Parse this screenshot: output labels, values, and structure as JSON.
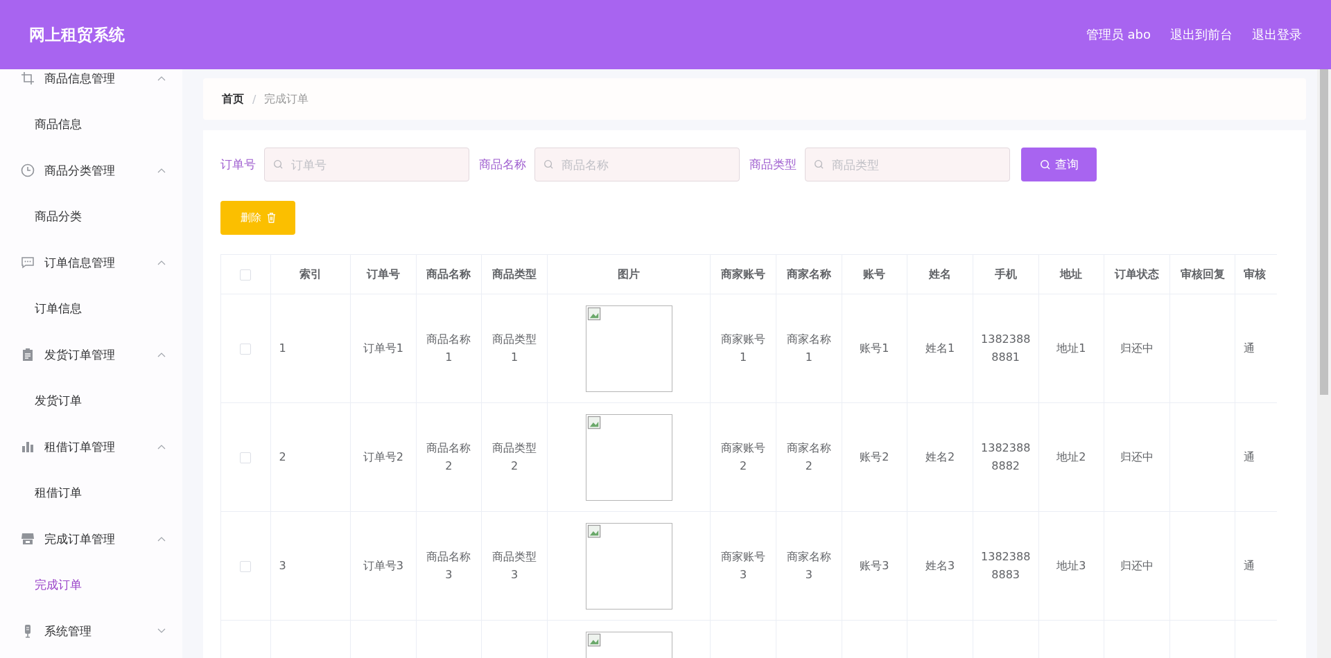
{
  "header": {
    "title": "网上租贸系统",
    "links": [
      "管理员 abo",
      "退出到前台",
      "退出登录"
    ]
  },
  "sidebar": {
    "groups": [
      {
        "label": "商品信息管理",
        "expanded": true,
        "children": [
          {
            "label": "商品信息",
            "selected": false
          }
        ]
      },
      {
        "label": "商品分类管理",
        "expanded": true,
        "children": [
          {
            "label": "商品分类",
            "selected": false
          }
        ]
      },
      {
        "label": "订单信息管理",
        "expanded": true,
        "children": [
          {
            "label": "订单信息",
            "selected": false
          }
        ]
      },
      {
        "label": "发货订单管理",
        "expanded": true,
        "children": [
          {
            "label": "发货订单",
            "selected": false
          }
        ]
      },
      {
        "label": "租借订单管理",
        "expanded": true,
        "children": [
          {
            "label": "租借订单",
            "selected": false
          }
        ]
      },
      {
        "label": "完成订单管理",
        "expanded": true,
        "children": [
          {
            "label": "完成订单",
            "selected": true
          }
        ]
      },
      {
        "label": "系统管理",
        "expanded": false
      }
    ]
  },
  "breadcrumb": {
    "separator": "/",
    "items": [
      "首页",
      "完成订单"
    ]
  },
  "search": {
    "fields": [
      {
        "label": "订单号",
        "placeholder": "订单号"
      },
      {
        "label": "商品名称",
        "placeholder": "商品名称"
      },
      {
        "label": "商品类型",
        "placeholder": "商品类型"
      }
    ],
    "button": "查询"
  },
  "delete_button": "删除",
  "table": {
    "select_all": false,
    "columns": [
      "索引",
      "订单号",
      "商品名称",
      "商品类型",
      "图片",
      "商家账号",
      "商家名称",
      "账号",
      "姓名",
      "手机",
      "地址",
      "订单状态",
      "审核回复",
      "审核"
    ],
    "rows": [
      {
        "checked": false,
        "cells": [
          "1",
          "订单号1",
          "商品名称1",
          "商品类型1",
          {
            "kind": "picture"
          },
          "商家账号1",
          "商家名称1",
          "账号1",
          "姓名1",
          "13823888881",
          "地址1",
          "归还中",
          "",
          "通"
        ]
      },
      {
        "checked": false,
        "cells": [
          "2",
          "订单号2",
          "商品名称2",
          "商品类型2",
          {
            "kind": "picture"
          },
          "商家账号2",
          "商家名称2",
          "账号2",
          "姓名2",
          "13823888882",
          "地址2",
          "归还中",
          "",
          "通"
        ]
      },
      {
        "checked": false,
        "cells": [
          "3",
          "订单号3",
          "商品名称3",
          "商品类型3",
          {
            "kind": "picture"
          },
          "商家账号3",
          "商家名称3",
          "账号3",
          "姓名3",
          "13823888883",
          "地址3",
          "归还中",
          "",
          "通"
        ]
      },
      {
        "cells": [
          {
            "kind": "picture"
          }
        ]
      }
    ]
  }
}
